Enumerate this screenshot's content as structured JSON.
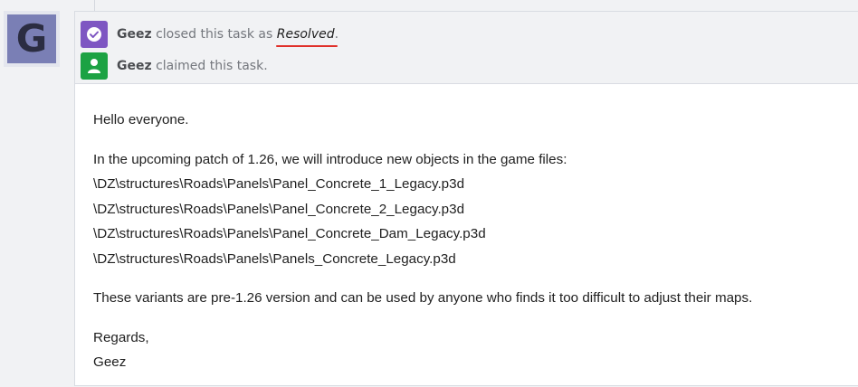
{
  "avatar": {
    "initial": "G",
    "color": "#7a7fb5"
  },
  "events": [
    {
      "icon": "check-circle-icon",
      "icon_color": "#7e56c2",
      "author": "Geez",
      "action": "closed this task as",
      "status": "Resolved",
      "suffix": "."
    },
    {
      "icon": "user-icon",
      "icon_color": "#1ca243",
      "author": "Geez",
      "action": "claimed this task."
    }
  ],
  "comment": {
    "greeting": "Hello everyone.",
    "intro": "In the upcoming patch of 1.26, we will introduce new objects in the game files:",
    "paths": [
      "\\DZ\\structures\\Roads\\Panels\\Panel_Concrete_1_Legacy.p3d",
      "\\DZ\\structures\\Roads\\Panels\\Panel_Concrete_2_Legacy.p3d",
      "\\DZ\\structures\\Roads\\Panels\\Panel_Concrete_Dam_Legacy.p3d",
      "\\DZ\\structures\\Roads\\Panels\\Panels_Concrete_Legacy.p3d"
    ],
    "note": "These variants are pre-1.26 version and can be used by anyone who finds it too difficult to adjust their maps.",
    "closing": "Regards,",
    "signature": "Geez"
  },
  "colors": {
    "highlight_underline": "#e0302a",
    "background": "#f1f2f4"
  }
}
